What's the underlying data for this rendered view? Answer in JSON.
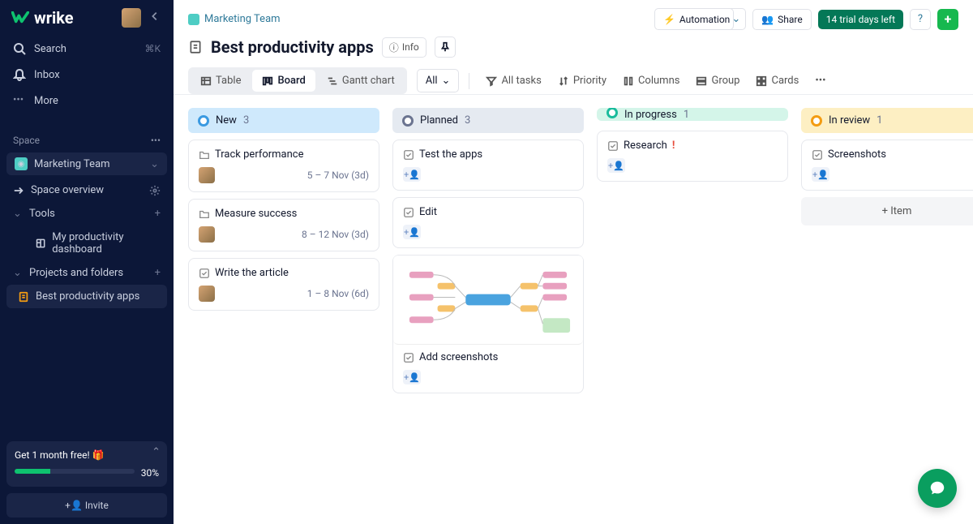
{
  "app": {
    "name": "wrike"
  },
  "sidebar": {
    "search": "Search",
    "search_kbd": "⌘K",
    "inbox": "Inbox",
    "more": "More",
    "space_label": "Space",
    "space_name": "Marketing Team",
    "space_overview": "Space overview",
    "tools": "Tools",
    "dashboard": "My productivity dashboard",
    "projects": "Projects and folders",
    "project_active": "Best productivity apps",
    "promo_title": "Get 1 month free! 🎁",
    "promo_pct": "30%",
    "invite": "Invite"
  },
  "header": {
    "breadcrumb": "Marketing Team",
    "automation": "Automation",
    "share": "Share",
    "trial": "14 trial days left",
    "title": "Best productivity apps",
    "info": "Info"
  },
  "views": {
    "table": "Table",
    "board": "Board",
    "gantt": "Gantt chart",
    "filter_all": "All"
  },
  "toolbar": {
    "all_tasks": "All tasks",
    "priority": "Priority",
    "columns": "Columns",
    "group": "Group",
    "cards": "Cards"
  },
  "columns": [
    {
      "key": "new",
      "name": "New",
      "count": "3"
    },
    {
      "key": "planned",
      "name": "Planned",
      "count": "3"
    },
    {
      "key": "progress",
      "name": "In progress",
      "count": "1"
    },
    {
      "key": "review",
      "name": "In review",
      "count": "1"
    }
  ],
  "cards": {
    "new": [
      {
        "title": "Track performance",
        "date": "5 – 7 Nov (3d)",
        "type": "folder",
        "avatar": true
      },
      {
        "title": "Measure success",
        "date": "8 – 12 Nov (3d)",
        "type": "folder",
        "avatar": true
      },
      {
        "title": "Write the article",
        "date": "1 – 8 Nov (6d)",
        "type": "task",
        "avatar": true
      }
    ],
    "planned": [
      {
        "title": "Test the apps",
        "type": "task",
        "assign": true
      },
      {
        "title": "Edit",
        "type": "task",
        "assign": true
      },
      {
        "title": "Add screenshots",
        "type": "task",
        "assign": true,
        "mindmap": true
      }
    ],
    "progress": [
      {
        "title": "Research",
        "type": "task",
        "priority": "high",
        "assign": true
      }
    ],
    "review": [
      {
        "title": "Screenshots",
        "type": "task",
        "assign": true
      }
    ]
  },
  "add_item": "+ Item"
}
